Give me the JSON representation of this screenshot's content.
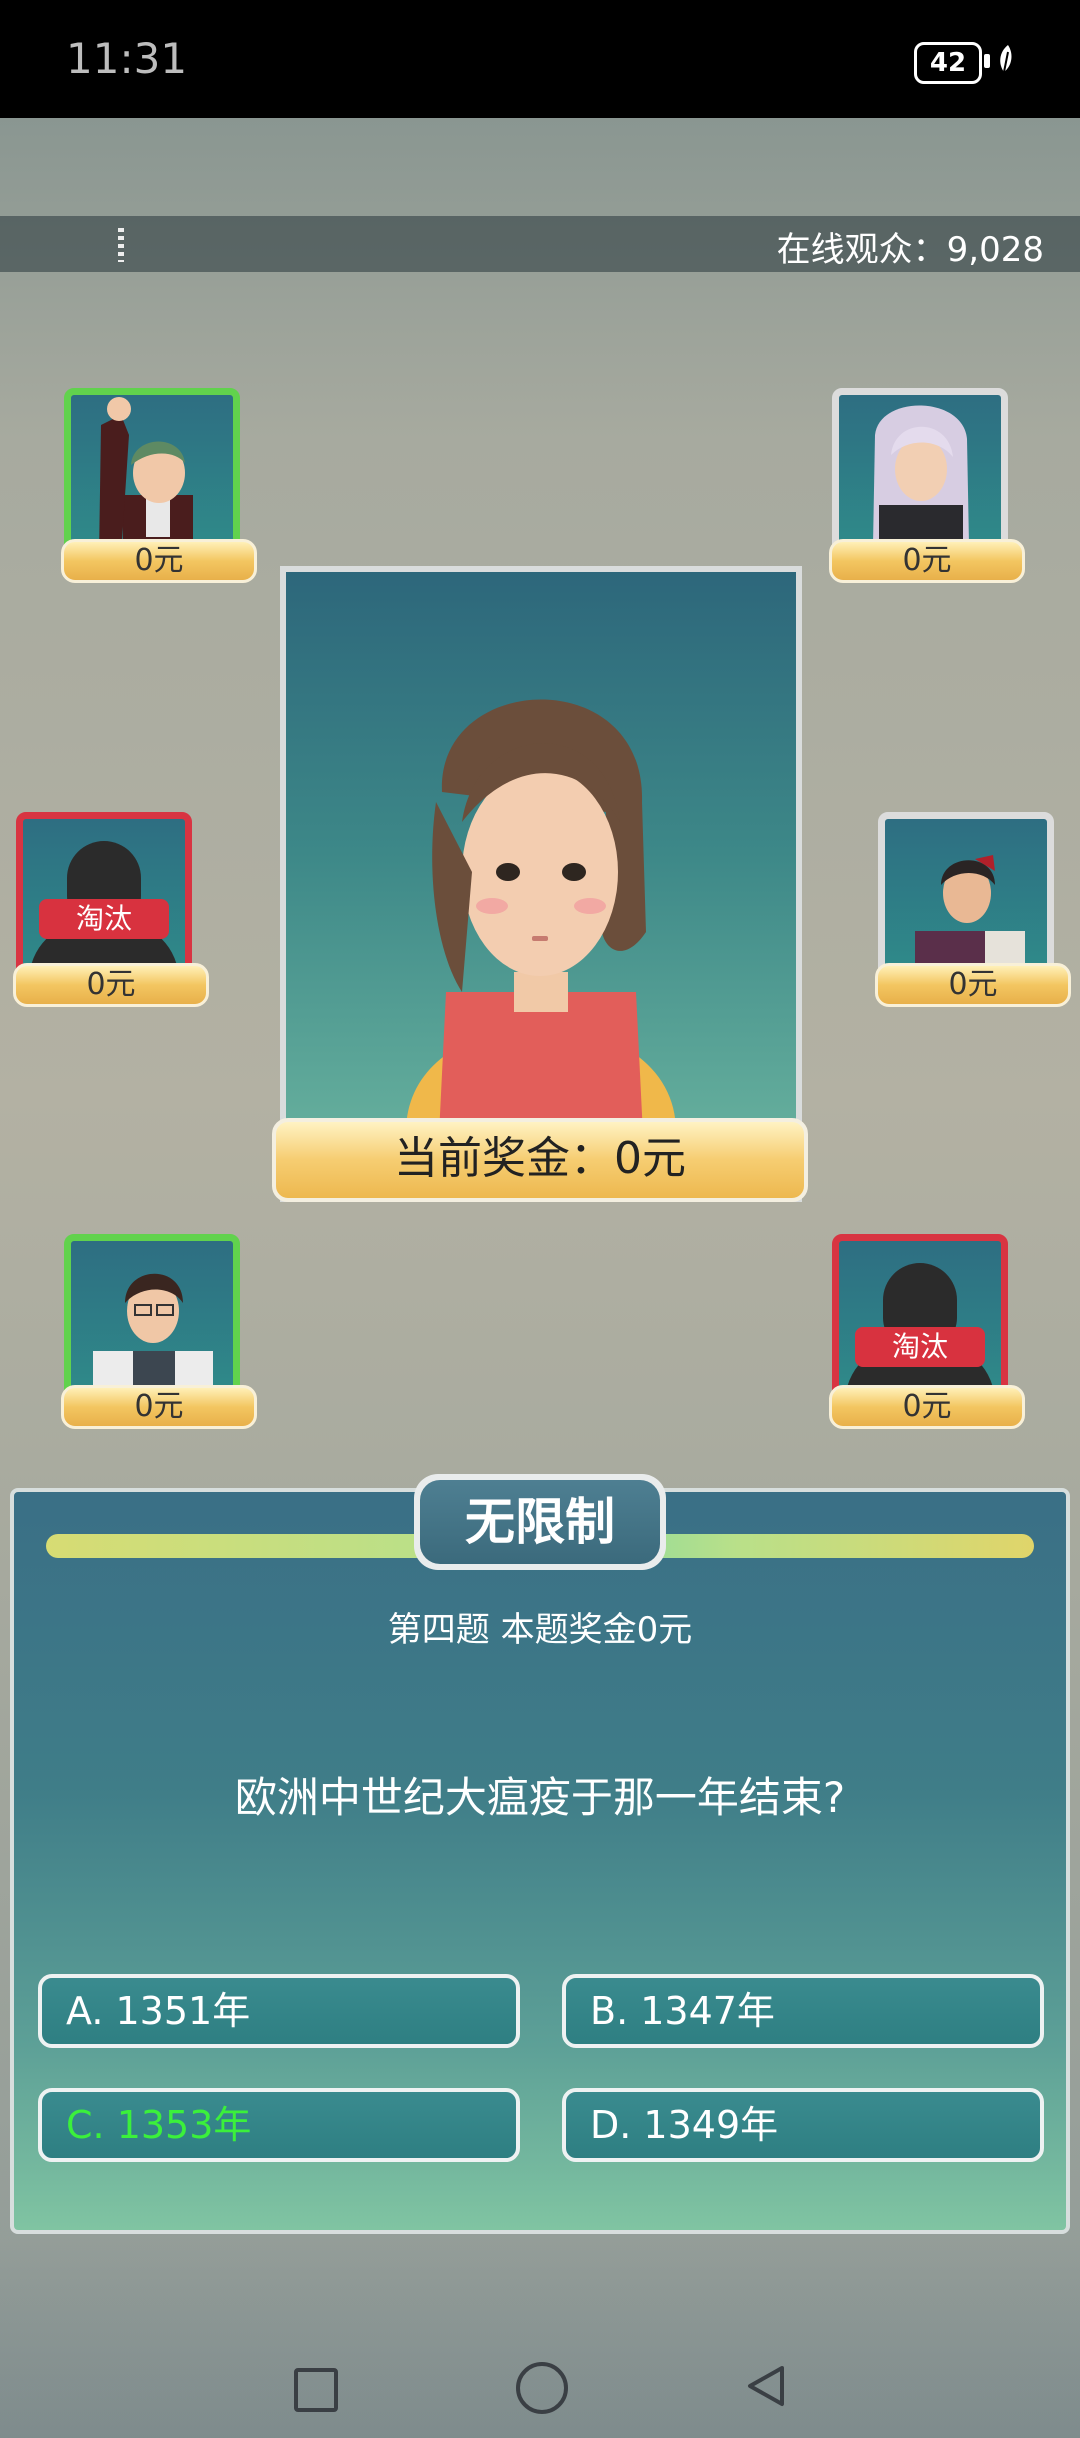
{
  "status_bar": {
    "time": "11:31",
    "battery": "42"
  },
  "header": {
    "audience": "在线观众：9,028"
  },
  "players": [
    {
      "prize": "0元",
      "status": "active"
    },
    {
      "prize": "0元",
      "status": "idle"
    },
    {
      "prize": "0元",
      "status": "eliminated",
      "tag": "淘汰"
    },
    {
      "prize": "0元",
      "status": "idle"
    },
    {
      "prize": "0元",
      "status": "active"
    },
    {
      "prize": "0元",
      "status": "eliminated",
      "tag": "淘汰"
    }
  ],
  "host": {
    "prize_label": "当前奖金：0元"
  },
  "question": {
    "mode": "无限制",
    "info": "第四题 本题奖金0元",
    "text": "欧洲中世纪大瘟疫于那一年结束?",
    "options": [
      {
        "label": "A. 1351年"
      },
      {
        "label": "B. 1347年"
      },
      {
        "label": "C. 1353年",
        "highlight": true
      },
      {
        "label": "D. 1349年"
      }
    ]
  },
  "colors": {
    "correct": "#3bf03b",
    "eliminated": "#d83442",
    "active_border": "#61d24d"
  }
}
